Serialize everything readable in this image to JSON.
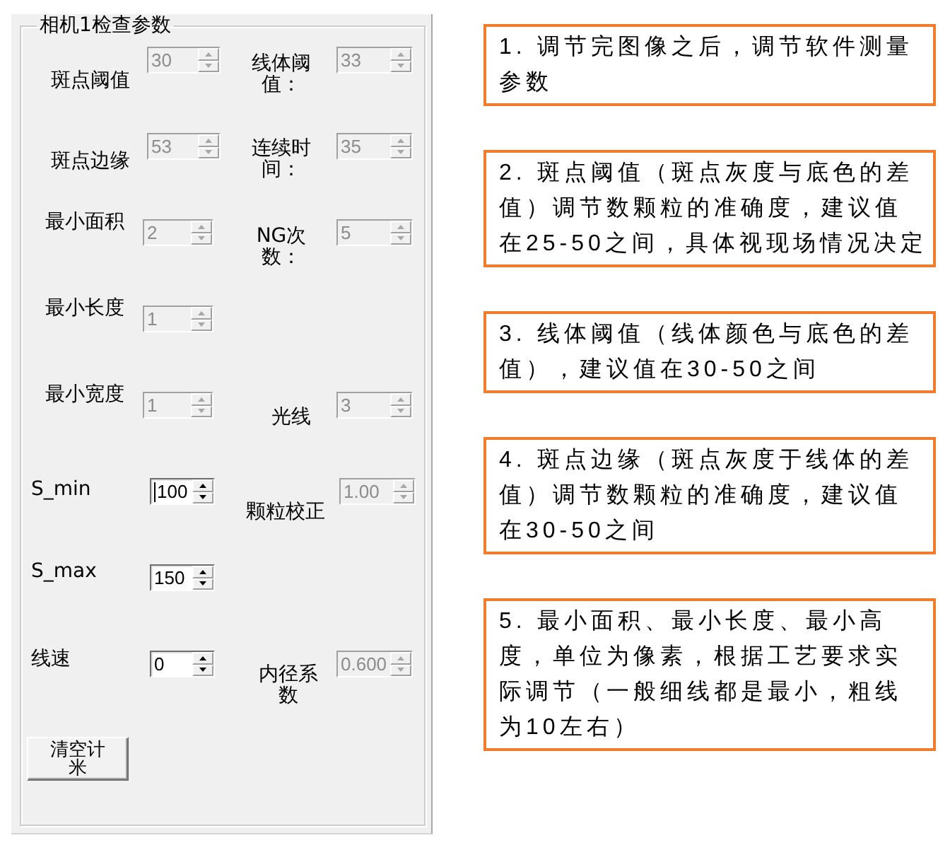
{
  "panel": {
    "title": "相机1检查参数",
    "rows": [
      {
        "left": {
          "label": "斑点阈值",
          "value": "30",
          "disabled": true,
          "focused": false
        },
        "right": {
          "label": "线体阈值：",
          "value": "33",
          "disabled": true,
          "focused": false
        }
      },
      {
        "left": {
          "label": "斑点边缘",
          "value": "53",
          "disabled": true,
          "focused": false
        },
        "right": {
          "label": "连续时间：",
          "value": "35",
          "disabled": true,
          "focused": false
        }
      },
      {
        "left": {
          "label": "最小面积",
          "value": "2",
          "disabled": true,
          "focused": false
        },
        "right": {
          "label": "NG次数：",
          "value": "5",
          "disabled": true,
          "focused": false
        }
      },
      {
        "left": {
          "label": "最小长度",
          "value": "1",
          "disabled": true,
          "focused": false
        }
      },
      {
        "left": {
          "label": "最小宽度",
          "value": "1",
          "disabled": true,
          "focused": false
        },
        "right": {
          "label": "光线",
          "value": "3",
          "disabled": true,
          "focused": false
        }
      },
      {
        "left": {
          "label": "S_min",
          "value": "100",
          "disabled": false,
          "focused": true
        },
        "right": {
          "label": "颗粒校正",
          "value": "1.00",
          "disabled": true,
          "focused": false
        }
      },
      {
        "left": {
          "label": "S_max",
          "value": "150",
          "disabled": false,
          "focused": false
        }
      },
      {
        "left": {
          "label": "线速",
          "value": "0",
          "disabled": false,
          "focused": false
        },
        "right": {
          "label": "内径系数",
          "value": "0.600",
          "disabled": true,
          "focused": false
        }
      }
    ],
    "button": "清空计米"
  },
  "notes": [
    "1. 调节完图像之后，调节软件测量参数",
    "2. 斑点阈值（斑点灰度与底色的差值）调节数颗粒的准确度，建议值在25-50之间，具体视现场情况决定",
    "3. 线体阈值（线体颜色与底色的差值），建议值在30-50之间",
    "4. 斑点边缘（斑点灰度于线体的差值）调节数颗粒的准确度，建议值在30-50之间",
    "5. 最小面积、最小长度、最小高度，单位为像素，根据工艺要求实际调节（一般细线都是最小，粗线为10左右）"
  ]
}
